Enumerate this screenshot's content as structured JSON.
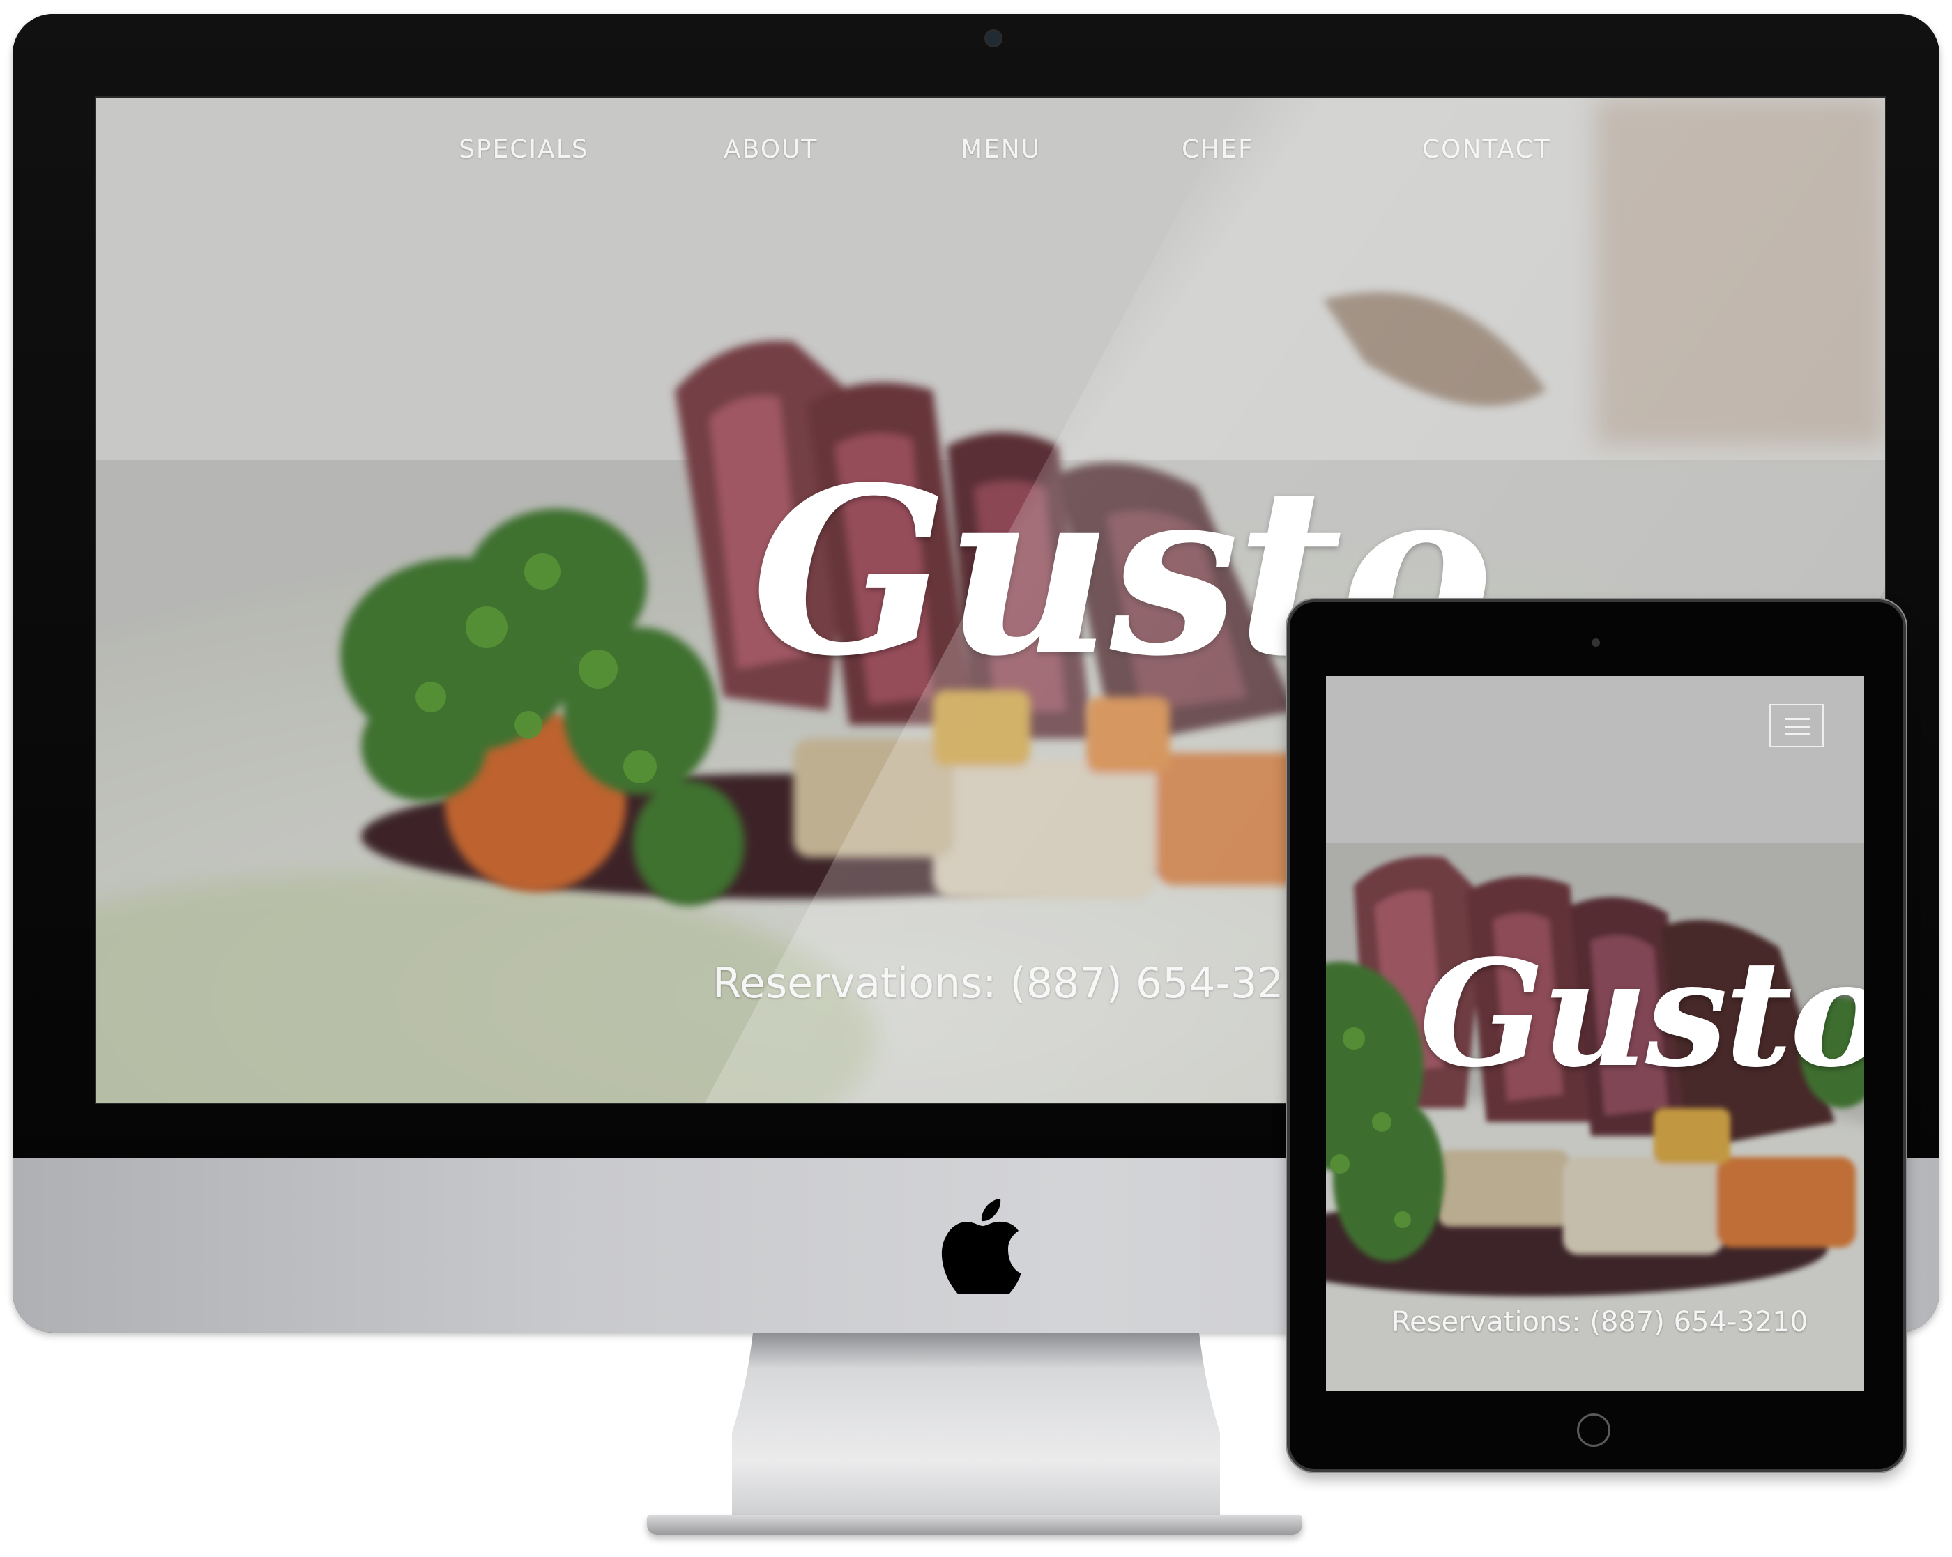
{
  "site": {
    "brand": "Gusto",
    "nav": [
      "SPECIALS",
      "ABOUT",
      "MENU",
      "CHEF",
      "CONTACT"
    ],
    "reservations": "Reservations: (887) 654-3210"
  },
  "devices": {
    "desktop_icon": "apple-logo-icon",
    "tablet_menu_icon": "hamburger-menu-icon"
  },
  "colors": {
    "text": "#ffffff",
    "overlay": "#6e6e6e"
  }
}
